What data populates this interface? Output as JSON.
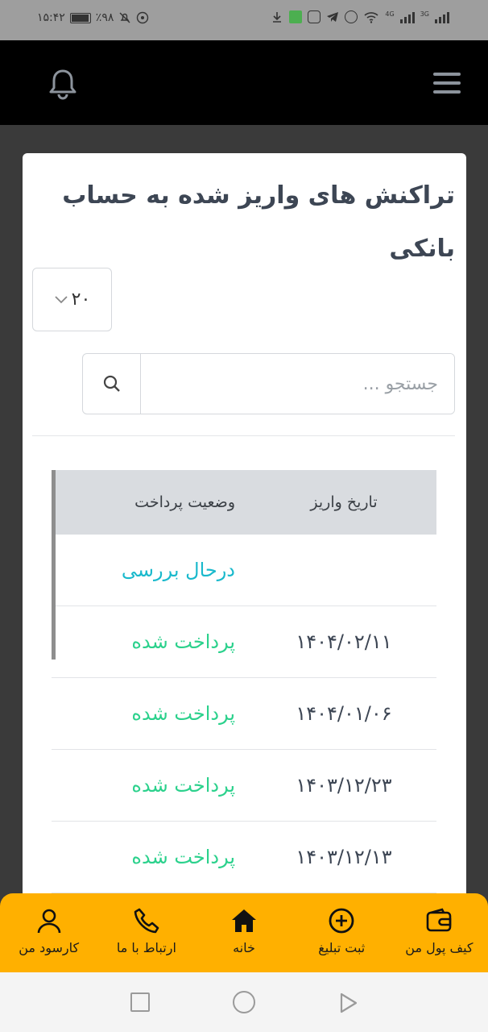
{
  "status_bar": {
    "time": "۱۵:۴۲",
    "battery": "٪۹۸",
    "network_labels": [
      "4G",
      "3G"
    ]
  },
  "header": {
    "menu_icon": "hamburger-icon",
    "notification_icon": "bell-icon"
  },
  "card": {
    "title": "تراکنش های واریز شده به حساب بانکی",
    "page_size": "۲۰",
    "search": {
      "placeholder": "جستجو ..."
    }
  },
  "table": {
    "columns": [
      "تاریخ واریز",
      "وضعیت پرداخت"
    ],
    "rows": [
      {
        "date": "",
        "status": "درحال بررسی",
        "status_kind": "review"
      },
      {
        "date": "۱۴۰۴/۰۲/۱۱",
        "status": "پرداخت شده",
        "status_kind": "paid"
      },
      {
        "date": "۱۴۰۴/۰۱/۰۶",
        "status": "پرداخت شده",
        "status_kind": "paid"
      },
      {
        "date": "۱۴۰۳/۱۲/۲۳",
        "status": "پرداخت شده",
        "status_kind": "paid"
      },
      {
        "date": "۱۴۰۳/۱۲/۱۳",
        "status": "پرداخت شده",
        "status_kind": "paid"
      }
    ]
  },
  "bottom_nav": {
    "items": [
      {
        "label": "کیف پول من",
        "icon": "wallet-icon"
      },
      {
        "label": "ثبت تبلیغ",
        "icon": "plus-circle-icon"
      },
      {
        "label": "خانه",
        "icon": "home-icon"
      },
      {
        "label": "ارتباط با ما",
        "icon": "phone-icon"
      },
      {
        "label": "کارسود من",
        "icon": "user-icon"
      }
    ]
  },
  "colors": {
    "accent": "#ffb000",
    "status_review": "#19b9cc",
    "status_paid": "#2bd18c",
    "header_bg": "#000000"
  }
}
